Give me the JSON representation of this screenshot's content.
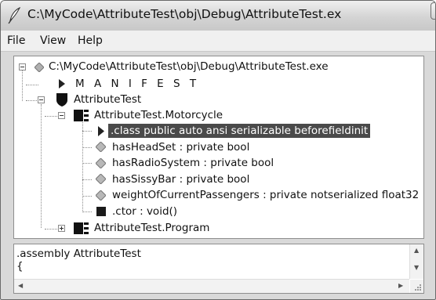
{
  "window": {
    "title": "C:\\MyCode\\AttributeTest\\obj\\Debug\\AttributeTest.exe ...",
    "icon": "feather-icon",
    "buttons": [
      "minimize-icon",
      "maximize-icon",
      "close-icon"
    ]
  },
  "menu": {
    "items": [
      "File",
      "View",
      "Help"
    ]
  },
  "tree": {
    "root": "C:\\MyCode\\AttributeTest\\obj\\Debug\\AttributeTest.exe",
    "manifest": "M A N I F E S T",
    "namespace": "AttributeTest",
    "class_motorcycle": "AttributeTest.Motorcycle",
    "class_directive": ".class public auto ansi serializable beforefieldinit",
    "fields": [
      "hasHeadSet : private bool",
      "hasRadioSystem : private bool",
      "hasSissyBar : private bool",
      "weightOfCurrentPassengers : private notserialized float32"
    ],
    "ctor": ".ctor : void()",
    "class_program": "AttributeTest.Program"
  },
  "detail": {
    "text": ".assembly AttributeTest\n{"
  },
  "colors": {
    "selection": "#4a4a4a",
    "titlebar": "#d4d4d4",
    "close_button": "#bdbdbd"
  }
}
